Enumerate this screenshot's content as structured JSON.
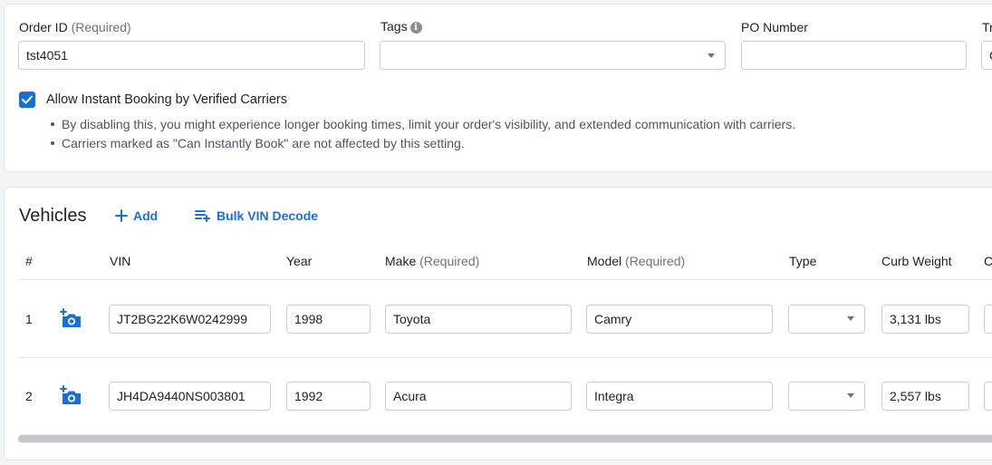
{
  "order": {
    "order_id_label": "Order ID",
    "order_id_req": "(Required)",
    "order_id_value": "tst4051",
    "tags_label": "Tags",
    "po_label": "PO Number",
    "po_value": "",
    "truncated_label": "Tr",
    "truncated_value": "C"
  },
  "instant_booking": {
    "checked": true,
    "label": "Allow Instant Booking by Verified Carriers",
    "notes": [
      "By disabling this, you might experience longer booking times, limit your order's visibility, and extended communication with carriers.",
      "Carriers marked as \"Can Instantly Book\" are not affected by this setting."
    ]
  },
  "vehicles": {
    "title": "Vehicles",
    "add_label": "Add",
    "bulk_label": "Bulk VIN Decode",
    "columns": {
      "num": "#",
      "vin": "VIN",
      "year": "Year",
      "make": "Make",
      "make_req": "(Required)",
      "model": "Model",
      "model_req": "(Required)",
      "type": "Type",
      "curb_weight": "Curb Weight",
      "truncated": "C"
    },
    "rows": [
      {
        "num": "1",
        "vin": "JT2BG22K6W0242999",
        "year": "1998",
        "make": "Toyota",
        "model": "Camry",
        "type": "",
        "curb_weight": "3,131 lbs"
      },
      {
        "num": "2",
        "vin": "JH4DA9440NS003801",
        "year": "1992",
        "make": "Acura",
        "model": "Integra",
        "type": "",
        "curb_weight": "2,557 lbs"
      }
    ]
  },
  "colors": {
    "accent": "#1a6fd4",
    "border": "#c9cdd2",
    "background": "#f3f4f6"
  },
  "icons": {
    "checkbox": "check-icon",
    "tags_info": "info-icon",
    "add": "plus-icon",
    "bulk": "list-add-icon",
    "camera": "camera-add-icon",
    "dropdown": "chevron-down-icon"
  }
}
